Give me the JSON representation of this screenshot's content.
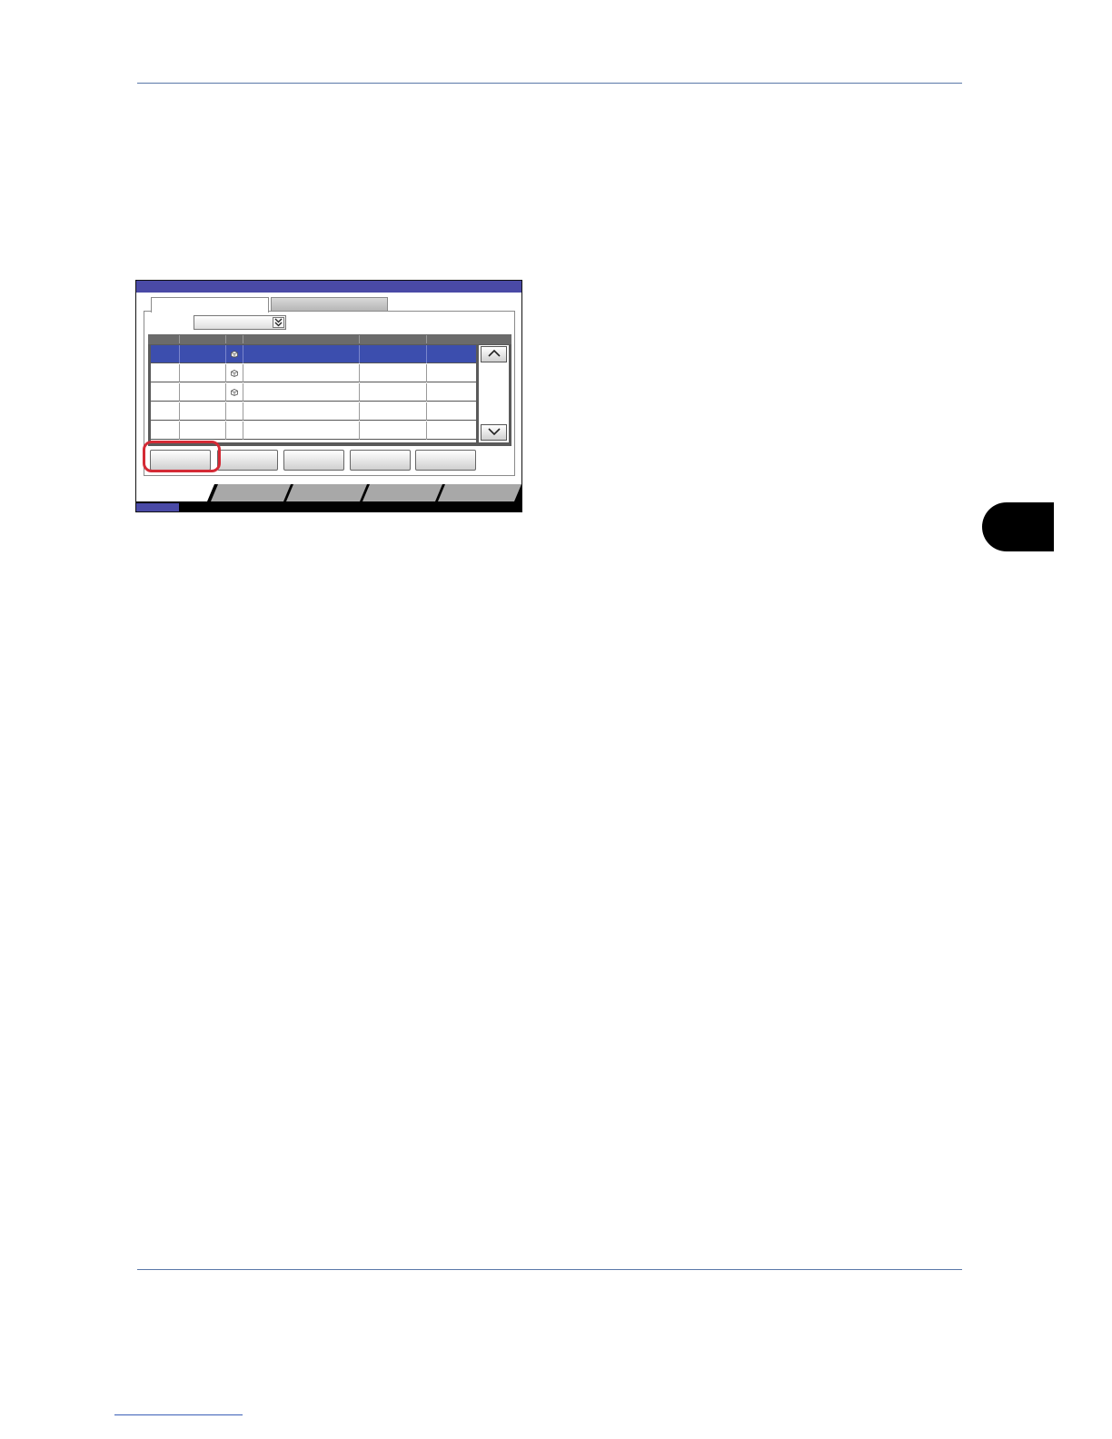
{
  "colors": {
    "accent": "#4a4aa6",
    "selected_row": "#3c4eae",
    "highlight": "#d42a35"
  },
  "screen": {
    "title": "",
    "tabs": [
      {
        "label": ""
      },
      {
        "label": ""
      }
    ],
    "dropdown": {
      "value": "",
      "icon": "chevron-double-down-icon"
    },
    "list": {
      "selected_index": 0,
      "rows": [
        {
          "icon": "box-icon"
        },
        {
          "icon": "box-icon"
        },
        {
          "icon": "box-icon"
        },
        {
          "icon": ""
        },
        {
          "icon": ""
        }
      ]
    },
    "scroll": {
      "up_icon": "chevron-up-icon",
      "down_icon": "chevron-down-icon"
    },
    "action_buttons": [
      {
        "label": ""
      },
      {
        "label": ""
      },
      {
        "label": ""
      },
      {
        "label": ""
      },
      {
        "label": ""
      }
    ],
    "highlighted_button_index": 0,
    "bottom_tabs": [
      {
        "label": ""
      },
      {
        "label": ""
      },
      {
        "label": ""
      },
      {
        "label": ""
      },
      {
        "label": ""
      }
    ]
  }
}
